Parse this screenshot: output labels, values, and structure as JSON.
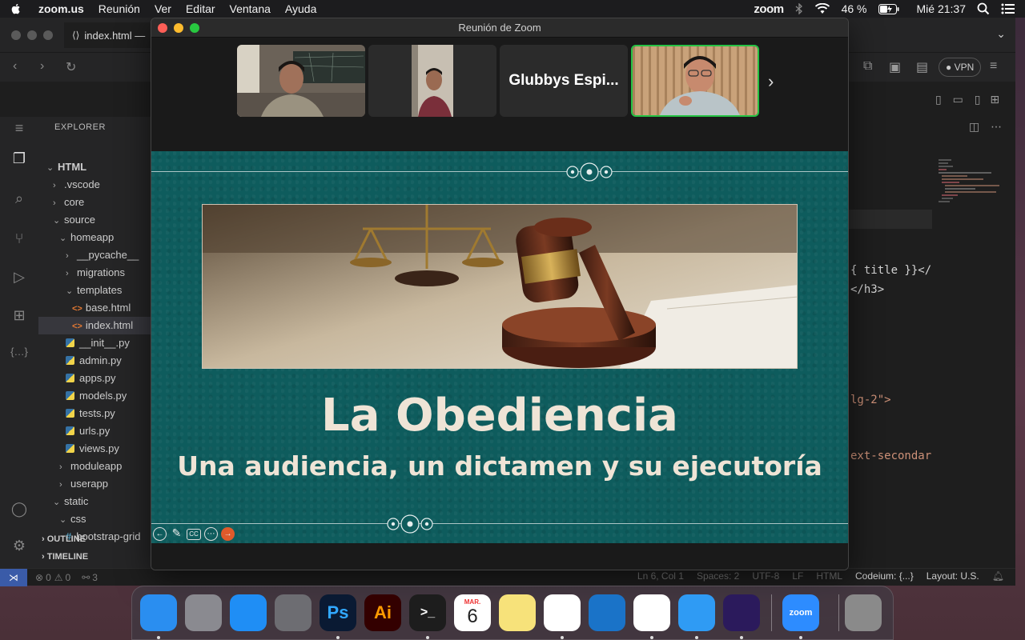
{
  "menubar": {
    "app_name": "zoom.us",
    "menus": [
      "Reunión",
      "Ver",
      "Editar",
      "Ventana",
      "Ayuda"
    ],
    "zoom_label": "zoom",
    "battery": "46 %",
    "clock": "Mié 21:37"
  },
  "vscode": {
    "tab_title": "index.html —",
    "explorer_title": "EXPLORER",
    "tree": [
      {
        "label": "HTML",
        "depth": 0,
        "chev": "⌄",
        "bold": true
      },
      {
        "label": ".vscode",
        "depth": 1,
        "chev": "›"
      },
      {
        "label": "core",
        "depth": 1,
        "chev": "›"
      },
      {
        "label": "source",
        "depth": 1,
        "chev": "⌄"
      },
      {
        "label": "homeapp",
        "depth": 2,
        "chev": "⌄"
      },
      {
        "label": "__pycache__",
        "depth": 3,
        "chev": "›"
      },
      {
        "label": "migrations",
        "depth": 3,
        "chev": "›"
      },
      {
        "label": "templates",
        "depth": 3,
        "chev": "⌄"
      },
      {
        "label": "base.html",
        "depth": 4,
        "icon": "html"
      },
      {
        "label": "index.html",
        "depth": 4,
        "icon": "html",
        "selected": true
      },
      {
        "label": "__init__.py",
        "depth": 3,
        "icon": "py"
      },
      {
        "label": "admin.py",
        "depth": 3,
        "icon": "py"
      },
      {
        "label": "apps.py",
        "depth": 3,
        "icon": "py"
      },
      {
        "label": "models.py",
        "depth": 3,
        "icon": "py"
      },
      {
        "label": "tests.py",
        "depth": 3,
        "icon": "py"
      },
      {
        "label": "urls.py",
        "depth": 3,
        "icon": "py"
      },
      {
        "label": "views.py",
        "depth": 3,
        "icon": "py"
      },
      {
        "label": "moduleapp",
        "depth": 2,
        "chev": "›"
      },
      {
        "label": "userapp",
        "depth": 2,
        "chev": "›"
      },
      {
        "label": "static",
        "depth": 1,
        "chev": "⌄"
      },
      {
        "label": "css",
        "depth": 2,
        "chev": "⌄"
      },
      {
        "label": "bootstrap-grid",
        "depth": 3,
        "icon": "css"
      }
    ],
    "outline_label": "OUTLINE",
    "timeline_label": "TIMELINE",
    "vpn_label": "VPN",
    "code_lines": [
      {
        "text": "{ title }}</",
        "color": "#d4d4d4"
      },
      {
        "text": "</h3>",
        "color": "#d4d4d4"
      },
      {
        "text": "lg-2\">",
        "color": "#ce9178"
      },
      {
        "text": "ext-secondar",
        "color": "#ce9178"
      }
    ],
    "status": {
      "errors": "0",
      "warnings": "0",
      "ports": "3",
      "position": "Ln 6, Col 1",
      "spaces": "Spaces: 2",
      "encoding": "UTF-8",
      "eol": "LF",
      "language": "HTML",
      "codeium": "Codeium: {...}",
      "layout": "Layout: U.S."
    }
  },
  "zoom": {
    "window_title": "Reunión de Zoom",
    "participants": [
      {
        "name": "",
        "type": "video"
      },
      {
        "name": "",
        "type": "video"
      },
      {
        "name": "Glubbys Espi...",
        "type": "name"
      },
      {
        "name": "",
        "type": "video",
        "active": true
      }
    ],
    "slide": {
      "title": "La Obediencia",
      "subtitle": "Una audiencia, un dictamen y su ejecutoría"
    },
    "slide_tools": [
      "back",
      "pen",
      "cc",
      "more",
      "next"
    ]
  },
  "dock": {
    "apps": [
      {
        "name": "Finder",
        "color": "#2a8ef0",
        "label": "",
        "running": true
      },
      {
        "name": "Launchpad",
        "color": "#8a8a90",
        "label": ""
      },
      {
        "name": "App Store",
        "color": "#1f8ef5",
        "label": ""
      },
      {
        "name": "System Preferences",
        "color": "#6d6d72",
        "label": ""
      },
      {
        "name": "Photoshop",
        "color": "#0a1a33",
        "label": "Ps",
        "text": "#31a8ff",
        "running": true
      },
      {
        "name": "Illustrator",
        "color": "#330000",
        "label": "Ai",
        "text": "#ff9a00"
      },
      {
        "name": "Terminal",
        "color": "#1d1d1d",
        "label": ">_",
        "running": true
      },
      {
        "name": "Calendar",
        "color": "#ffffff",
        "label": "6",
        "text": "#222"
      },
      {
        "name": "Notes",
        "color": "#f7e27a",
        "label": ""
      },
      {
        "name": "Visual Studio Code",
        "color": "#ffffff",
        "label": "",
        "running": true
      },
      {
        "name": "Edge",
        "color": "#1a73c8",
        "label": ""
      },
      {
        "name": "Brave",
        "color": "#ffffff",
        "label": "",
        "running": true
      },
      {
        "name": "Safari",
        "color": "#2f9bf4",
        "label": "",
        "running": true
      },
      {
        "name": "Firefox",
        "color": "#2b1a5c",
        "label": "",
        "running": true
      },
      {
        "name": "Zoom",
        "color": "#2d8cff",
        "label": "zoom",
        "running": true
      },
      {
        "name": "Trash",
        "color": "#8a8a8a",
        "label": ""
      }
    ],
    "calendar_month": "MAR."
  }
}
